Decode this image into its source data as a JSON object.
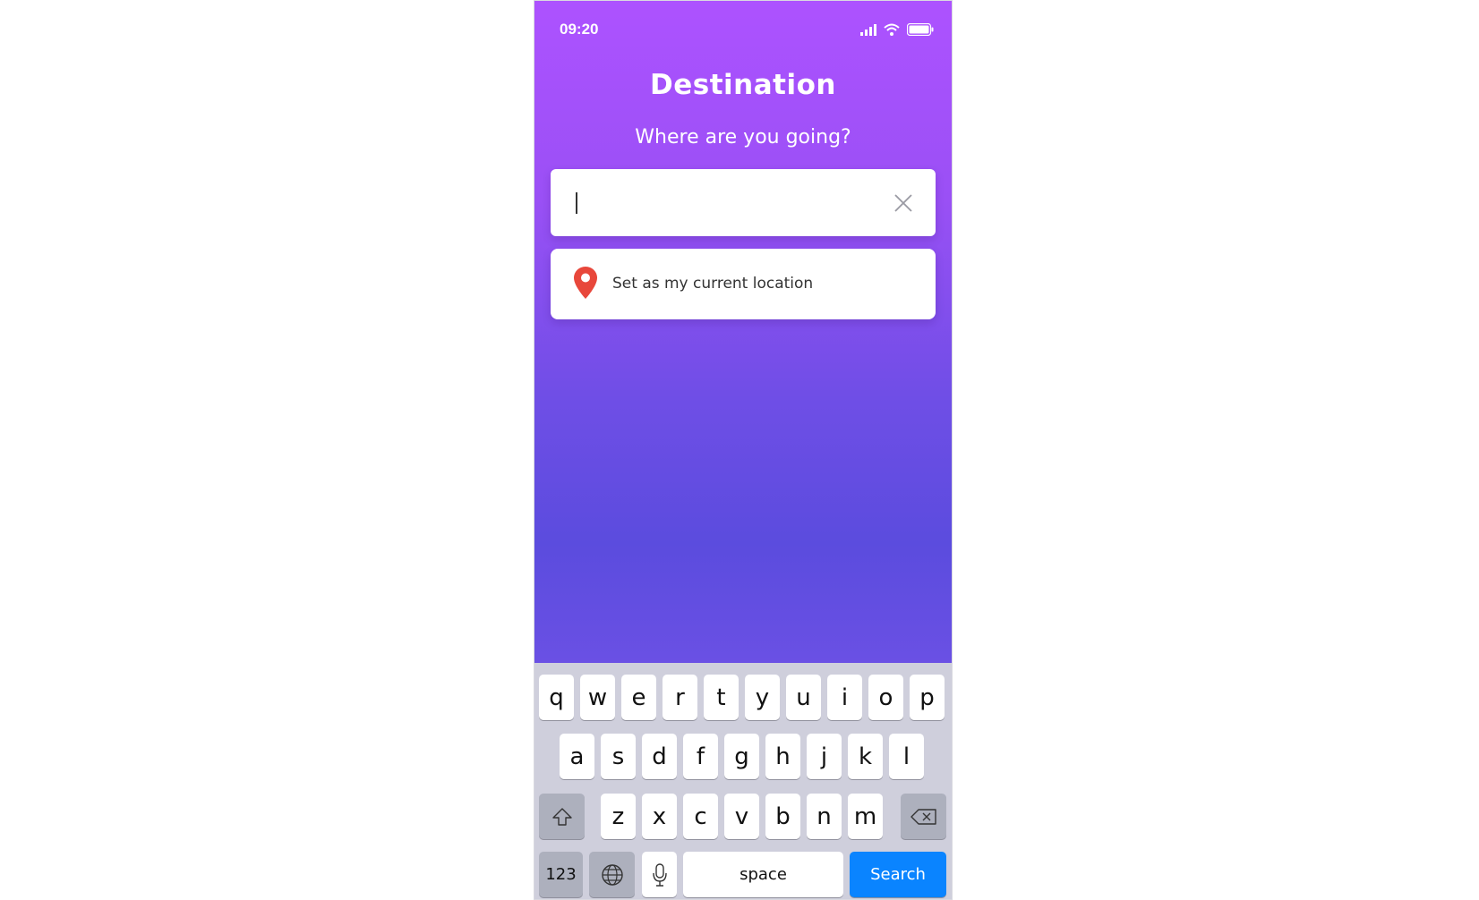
{
  "status_bar": {
    "time": "09:20"
  },
  "header": {
    "title": "Destination",
    "subtitle": "Where are you going?"
  },
  "search": {
    "value": "",
    "placeholder": ""
  },
  "location_option": {
    "label": "Set as my current location"
  },
  "keyboard": {
    "row1": [
      "q",
      "w",
      "e",
      "r",
      "t",
      "y",
      "u",
      "i",
      "o",
      "p"
    ],
    "row2": [
      "a",
      "s",
      "d",
      "f",
      "g",
      "h",
      "j",
      "k",
      "l"
    ],
    "row3": [
      "z",
      "x",
      "c",
      "v",
      "b",
      "n",
      "m"
    ],
    "numbers_label": "123",
    "space_label": "space",
    "action_label": "Search"
  },
  "colors": {
    "gradient_top": "#ad52ff",
    "gradient_bottom": "#5b4cde",
    "pin": "#e8473b",
    "action_key": "#0a84ff",
    "keyboard_bg": "#cfcfdc"
  }
}
